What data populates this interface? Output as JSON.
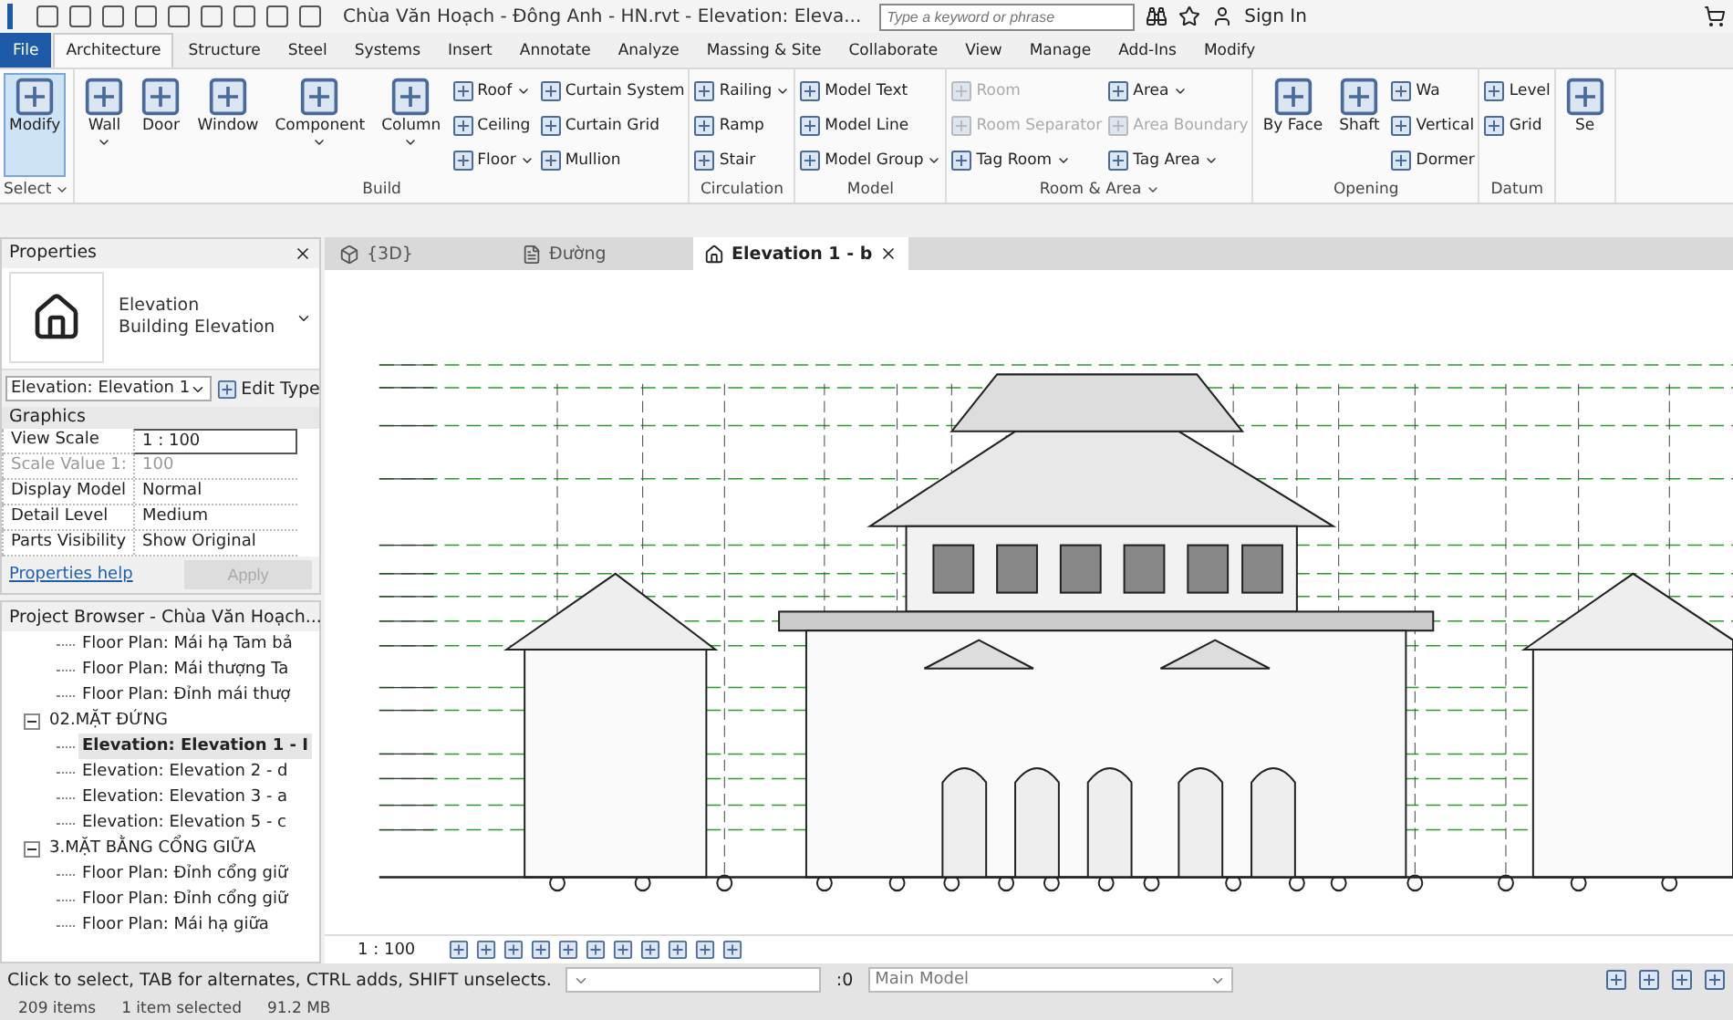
{
  "title_bar": {
    "title": "Chùa Văn Hoạch - Đông Anh - HN.rvt - Elevation: Eleva...",
    "search_placeholder": "Type a keyword or phrase",
    "sign_in": "Sign In"
  },
  "ribbon_tabs": [
    {
      "label": "File",
      "kind": "file",
      "selected": false
    },
    {
      "label": "Architecture",
      "kind": "tab",
      "selected": true
    },
    {
      "label": "Structure",
      "kind": "tab",
      "selected": false
    },
    {
      "label": "Steel",
      "kind": "tab",
      "selected": false
    },
    {
      "label": "Systems",
      "kind": "tab",
      "selected": false
    },
    {
      "label": "Insert",
      "kind": "tab",
      "selected": false
    },
    {
      "label": "Annotate",
      "kind": "tab",
      "selected": false
    },
    {
      "label": "Analyze",
      "kind": "tab",
      "selected": false
    },
    {
      "label": "Massing & Site",
      "kind": "tab",
      "selected": false
    },
    {
      "label": "Collaborate",
      "kind": "tab",
      "selected": false
    },
    {
      "label": "View",
      "kind": "tab",
      "selected": false
    },
    {
      "label": "Manage",
      "kind": "tab",
      "selected": false
    },
    {
      "label": "Add-Ins",
      "kind": "tab",
      "selected": false
    },
    {
      "label": "Modify",
      "kind": "tab",
      "selected": false
    }
  ],
  "ribbon_panels": [
    {
      "title": "Select",
      "dropdown": true,
      "large": [
        {
          "label": "Modify",
          "selected": true,
          "dropdown": false
        }
      ]
    },
    {
      "title": "Build",
      "dropdown": false,
      "large": [
        {
          "label": "Wall",
          "selected": false,
          "dropdown": true
        },
        {
          "label": "Door",
          "selected": false,
          "dropdown": false
        },
        {
          "label": "Window",
          "selected": false,
          "dropdown": false
        },
        {
          "label": "Component",
          "selected": false,
          "dropdown": true
        },
        {
          "label": "Column",
          "selected": false,
          "dropdown": true
        }
      ],
      "columns": [
        [
          {
            "label": "Roof",
            "dropdown": true,
            "disabled": false
          },
          {
            "label": "Ceiling",
            "dropdown": false,
            "disabled": false
          },
          {
            "label": "Floor",
            "dropdown": true,
            "disabled": false
          }
        ],
        [
          {
            "label": "Curtain System",
            "dropdown": false,
            "disabled": false
          },
          {
            "label": "Curtain Grid",
            "dropdown": false,
            "disabled": false
          },
          {
            "label": "Mullion",
            "dropdown": false,
            "disabled": false
          }
        ]
      ]
    },
    {
      "title": "Circulation",
      "dropdown": false,
      "columns": [
        [
          {
            "label": "Railing",
            "dropdown": true,
            "disabled": false
          },
          {
            "label": "Ramp",
            "dropdown": false,
            "disabled": false
          },
          {
            "label": "Stair",
            "dropdown": false,
            "disabled": false
          }
        ]
      ]
    },
    {
      "title": "Model",
      "dropdown": false,
      "columns": [
        [
          {
            "label": "Model Text",
            "dropdown": false,
            "disabled": false
          },
          {
            "label": "Model Line",
            "dropdown": false,
            "disabled": false
          },
          {
            "label": "Model Group",
            "dropdown": true,
            "disabled": false
          }
        ]
      ]
    },
    {
      "title": "Room & Area",
      "dropdown": true,
      "columns": [
        [
          {
            "label": "Room",
            "dropdown": false,
            "disabled": true
          },
          {
            "label": "Room Separator",
            "dropdown": false,
            "disabled": true
          },
          {
            "label": "Tag Room",
            "dropdown": true,
            "disabled": false
          }
        ],
        [
          {
            "label": "Area",
            "dropdown": true,
            "disabled": false
          },
          {
            "label": "Area Boundary",
            "dropdown": false,
            "disabled": true
          },
          {
            "label": "Tag Area",
            "dropdown": true,
            "disabled": false
          }
        ]
      ]
    },
    {
      "title": "Opening",
      "dropdown": false,
      "large": [
        {
          "label": "By Face",
          "selected": false,
          "dropdown": false
        },
        {
          "label": "Shaft",
          "selected": false,
          "dropdown": false
        }
      ],
      "columns": [
        [
          {
            "label": "Wa",
            "dropdown": false,
            "disabled": false
          },
          {
            "label": "Vertical",
            "dropdown": false,
            "disabled": false
          },
          {
            "label": "Dormer",
            "dropdown": false,
            "disabled": false
          }
        ]
      ]
    },
    {
      "title": "Datum",
      "dropdown": false,
      "columns": [
        [
          {
            "label": "Level",
            "dropdown": false,
            "disabled": false
          },
          {
            "label": "Grid",
            "dropdown": false,
            "disabled": false
          }
        ]
      ]
    },
    {
      "large": [
        {
          "label": "Se",
          "selected": false,
          "dropdown": false
        }
      ]
    }
  ],
  "properties": {
    "title": "Properties",
    "type_family": "Elevation",
    "type_name": "Building Elevation",
    "instance": "Elevation: Elevation 1",
    "edit_type": "Edit Type",
    "group": "Graphics",
    "rows": [
      {
        "name": "View Scale",
        "value": "1 : 100",
        "active": true,
        "disabled": false
      },
      {
        "name": "Scale Value    1:",
        "value": "100",
        "active": false,
        "disabled": true
      },
      {
        "name": "Display Model",
        "value": "Normal",
        "active": false,
        "disabled": false
      },
      {
        "name": "Detail Level",
        "value": "Medium",
        "active": false,
        "disabled": false
      },
      {
        "name": "Parts Visibility",
        "value": "Show Original",
        "active": false,
        "disabled": false
      }
    ],
    "help": "Properties help",
    "apply": "Apply"
  },
  "project_browser": {
    "title": "Project Browser - Chùa Văn Hoạch...",
    "tree": [
      {
        "children": [
          {
            "label": "Floor Plan: Mái hạ Tam bả",
            "selected": false
          },
          {
            "label": "Floor Plan: Mái thượng Ta",
            "selected": false
          },
          {
            "label": "Floor Plan: Đỉnh mái thượ",
            "selected": false
          }
        ]
      },
      {
        "label": "02.MẶT ĐỨNG",
        "expanded": true,
        "children": [
          {
            "label": "Elevation: Elevation 1 - I",
            "selected": true
          },
          {
            "label": "Elevation: Elevation 2 - d",
            "selected": false
          },
          {
            "label": "Elevation: Elevation 3 - a",
            "selected": false
          },
          {
            "label": "Elevation: Elevation 5 - c",
            "selected": false
          }
        ]
      },
      {
        "label": "3.MẶT BẰNG CỔNG GIỮA",
        "expanded": true,
        "children": [
          {
            "label": "Floor Plan: Đỉnh cổng giữ",
            "selected": false
          },
          {
            "label": "Floor Plan: Đỉnh cổng giữ",
            "selected": false
          },
          {
            "label": "Floor Plan: Mái hạ giữa",
            "selected": false
          }
        ]
      }
    ]
  },
  "view_tabs": [
    {
      "label": "{3D}",
      "kind": "model",
      "selected": false
    },
    {
      "label": "Đường",
      "kind": "plan",
      "selected": false
    },
    {
      "label": "Elevation 1 - b",
      "kind": "elevation",
      "selected": true
    }
  ],
  "view_bar": {
    "scale": "1 : 100"
  },
  "status_bar": {
    "message": "Click to select, TAB for alternates, CTRL adds, SHIFT unselects.",
    "filter_count": ":0",
    "model": "Main Model"
  },
  "footer": {
    "items": "209 items",
    "selected": "1 item selected",
    "memory": "91.2 MB"
  }
}
